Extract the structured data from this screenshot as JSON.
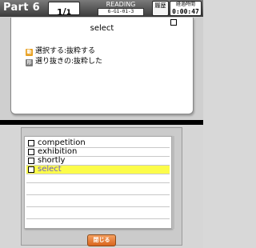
{
  "header": {
    "part_title": "Part 6",
    "page_current": "1",
    "page_separator": "/",
    "page_total": "1",
    "section_label": "READING",
    "section_code": "6-G1-01-3",
    "history_label": "履歴",
    "timer_label": "経過時間",
    "timer_value": "0:00:47"
  },
  "card": {
    "word": "select",
    "definitions": [
      {
        "icon": "verb-badge-icon",
        "badge": "動",
        "text": "選択する:抜粋する"
      },
      {
        "icon": "adjective-badge-icon",
        "badge": "形",
        "text": "選り抜きの:抜粋した"
      }
    ]
  },
  "word_list": {
    "items": [
      {
        "word": "competition",
        "selected": false
      },
      {
        "word": "exhibition",
        "selected": false
      },
      {
        "word": "shortly",
        "selected": false
      },
      {
        "word": "select",
        "selected": true
      }
    ]
  },
  "close_button_label": "閉じる",
  "colors": {
    "header_dark": "#3a3a3a",
    "verb_badge": "#e8a020",
    "selected_row": "#fcfc4a",
    "close_button": "#e07a30"
  }
}
